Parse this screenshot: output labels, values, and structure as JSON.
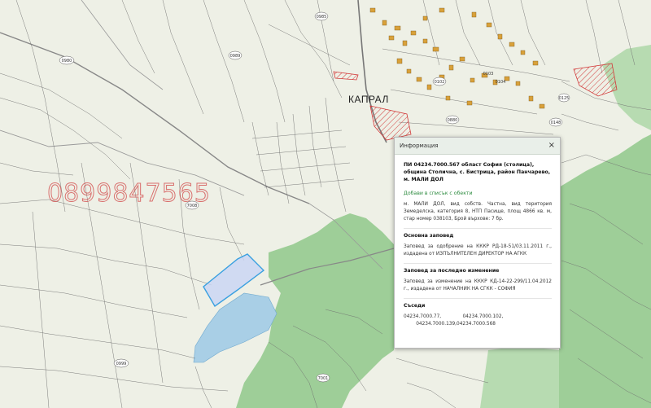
{
  "map": {
    "watermark_phone": "0899847565",
    "place_label": "КАПРАЛ",
    "parcel_numbers": [
      "0980",
      "0989",
      "0985",
      "7008",
      "0999",
      "7001",
      "0880",
      "0102",
      "0103",
      "0104",
      "0125",
      "0148"
    ]
  },
  "info_panel": {
    "header_title": "Информация",
    "close_glyph": "×",
    "parcel_title": "ПИ 04234.7000.567 област София (столица), община Столична, с. Бистрица, район Панчарево, м. МАЛИ ДОЛ",
    "add_to_list": "Добави в списък с обекти",
    "description": "м. МАЛИ ДОЛ, вид собств. Частна, вид територия Земеделска, категория 8, НТП Пасище, площ 4866 кв. м, стар номер 038103, Брой върхове: 7 бр.",
    "main_order_title": "Основна заповед",
    "main_order_text": "Заповед за одобрение на КККР РД-18-51/03.11.2011 г., издадена от ИЗПЪЛНИТЕЛЕН ДИРЕКТОР НА АГКК",
    "last_change_title": "Заповед за последно изменение",
    "last_change_text": "Заповед за изменение на КККР КД-14-22-299/11.04.2012 г., издадена от НАЧАЛНИК НА СГКК - СОФИЯ",
    "neighbors_title": "Съседи",
    "neighbors": [
      "04234.7000.77,",
      "04234.7000.102,",
      "04234.7000.139,",
      "04234.7000.568"
    ]
  },
  "colors": {
    "map_bg": "#eef0e6",
    "parcel_line": "#6f6f6f",
    "forest": "#8fc88a",
    "water": "#a9cfe6",
    "selected_fill": "#c8d4f5",
    "selected_stroke": "#3aa0e0",
    "hatch": "#d23a3a",
    "building": "#d9a13a",
    "link_green": "#2b8a3e"
  }
}
